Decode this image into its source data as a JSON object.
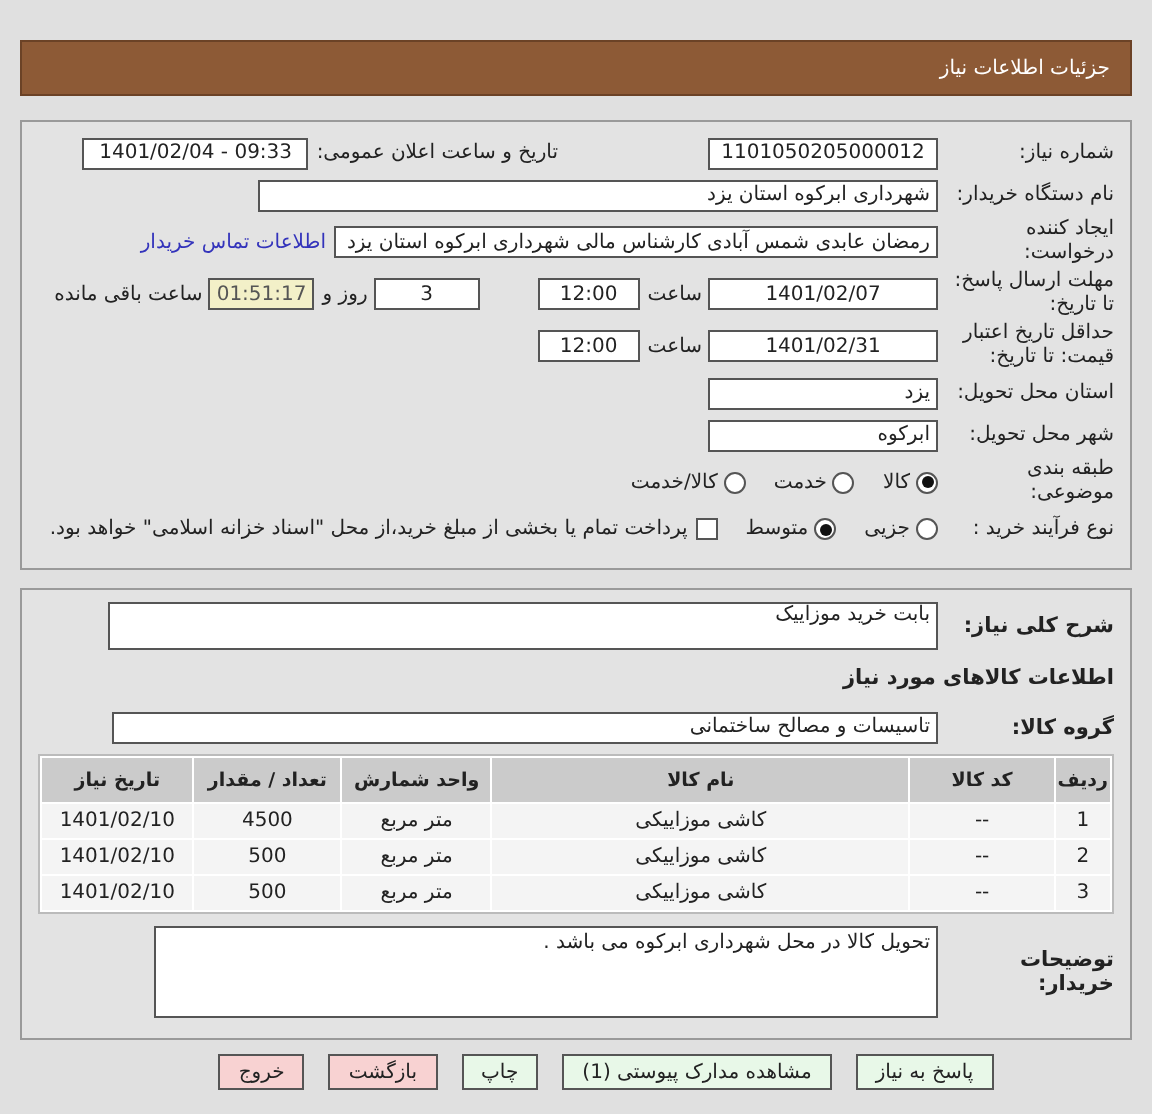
{
  "header": {
    "title": "جزئیات اطلاعات نیاز"
  },
  "details": {
    "need_number": {
      "label": "شماره نیاز:",
      "value": "1101050205000012"
    },
    "announce": {
      "label": "تاریخ و ساعت اعلان عمومی:",
      "value": "1401/02/04 - 09:33"
    },
    "buyer_org": {
      "label": "نام دستگاه خریدار:",
      "value": "شهرداری ابرکوه استان یزد"
    },
    "requester": {
      "label": "ایجاد کننده درخواست:",
      "value": "رمضان عابدی شمس آبادی کارشناس مالی شهرداری ابرکوه استان یزد",
      "link": "اطلاعات تماس خریدار"
    },
    "response_deadline": {
      "label": "مهلت ارسال پاسخ: تا تاریخ:",
      "date": "1401/02/07",
      "time_label": "ساعت",
      "time": "12:00",
      "days": "3",
      "days_label": "روز و",
      "remaining": "01:51:17",
      "remaining_label": "ساعت باقی مانده"
    },
    "price_validity": {
      "label": "حداقل تاریخ اعتبار قیمت: تا تاریخ:",
      "date": "1401/02/31",
      "time_label": "ساعت",
      "time": "12:00"
    },
    "province": {
      "label": "استان محل تحویل:",
      "value": "یزد"
    },
    "city": {
      "label": "شهر محل تحویل:",
      "value": "ابرکوه"
    },
    "category": {
      "label": "طبقه بندی موضوعی:",
      "options": [
        {
          "label": "کالا",
          "selected": true
        },
        {
          "label": "خدمت",
          "selected": false
        },
        {
          "label": "کالا/خدمت",
          "selected": false
        }
      ]
    },
    "purchase_process": {
      "label": "نوع فرآیند خرید :",
      "options": [
        {
          "label": "جزیی",
          "selected": false
        },
        {
          "label": "متوسط",
          "selected": true
        }
      ],
      "payment_note": {
        "label": "پرداخت تمام یا بخشی از مبلغ خرید،از محل \"اسناد خزانه اسلامی\" خواهد بود.",
        "checked": false
      }
    }
  },
  "goods": {
    "description": {
      "label": "شرح کلی نیاز:",
      "value": "بابت خرید موزاییک"
    },
    "section_title": "اطلاعات کالاهای مورد نیاز",
    "group": {
      "label": "گروه کالا:",
      "value": "تاسیسات و مصالح ساختمانی"
    },
    "table": {
      "columns": [
        "ردیف",
        "کد کالا",
        "نام کالا",
        "واحد شمارش",
        "تعداد / مقدار",
        "تاریخ نیاز"
      ],
      "rows": [
        [
          "1",
          "--",
          "کاشی موزاییکی",
          "متر مربع",
          "4500",
          "1401/02/10"
        ],
        [
          "2",
          "--",
          "کاشی موزاییکی",
          "متر مربع",
          "500",
          "1401/02/10"
        ],
        [
          "3",
          "--",
          "کاشی موزاییکی",
          "متر مربع",
          "500",
          "1401/02/10"
        ]
      ]
    },
    "buyer_notes": {
      "label": "توضیحات خریدار:",
      "value": "تحویل کالا در محل شهرداری ابرکوه می باشد ."
    }
  },
  "buttons": [
    {
      "label": "پاسخ به نیاز",
      "kind": "action"
    },
    {
      "label": "مشاهده مدارک پیوستی (1)",
      "kind": "action"
    },
    {
      "label": "چاپ",
      "kind": "action"
    },
    {
      "label": "بازگشت",
      "kind": "leave"
    },
    {
      "label": "خروج",
      "kind": "leave"
    }
  ]
}
